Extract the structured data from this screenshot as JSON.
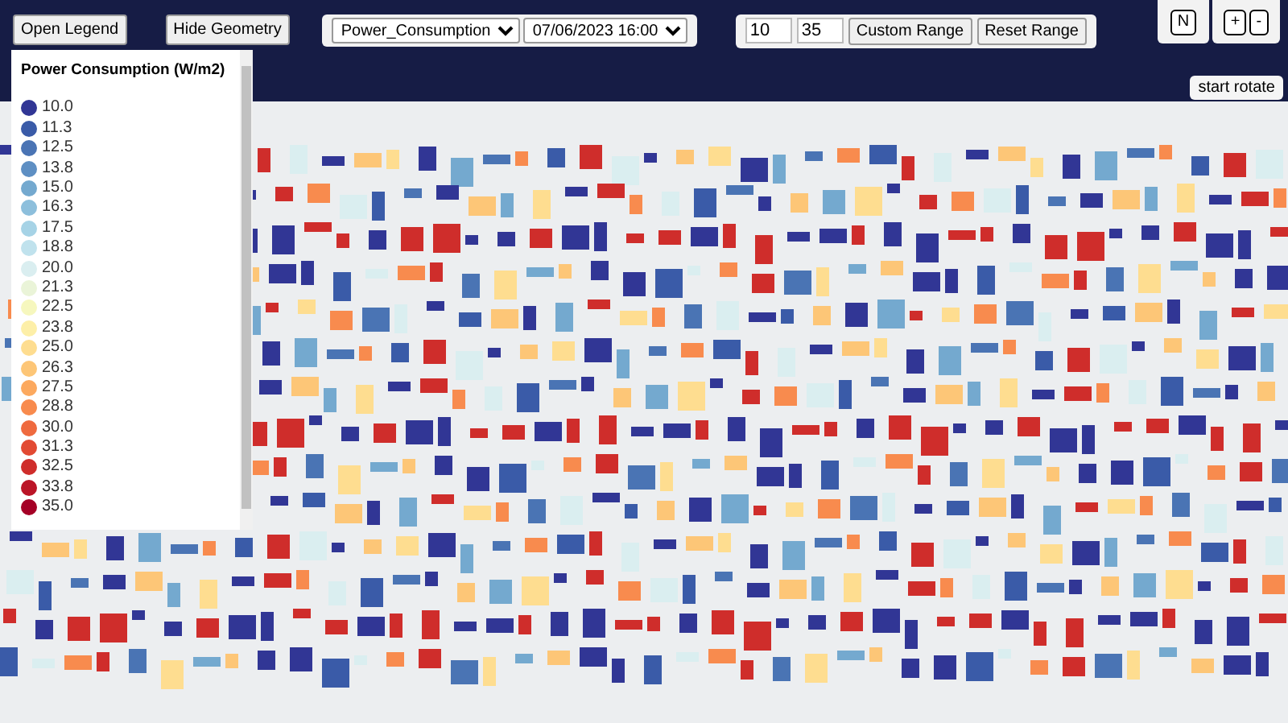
{
  "toolbar": {
    "open_legend": "Open Legend",
    "hide_geometry": "Hide Geometry",
    "metric_select": "Power_Consumption",
    "time_select": "07/06/2023 16:00",
    "range_min": "10",
    "range_max": "35",
    "custom_range": "Custom Range",
    "reset_range": "Reset Range"
  },
  "map_controls": {
    "compass": "N",
    "zoom_in": "+",
    "zoom_out": "-",
    "rotate": "start rotate"
  },
  "legend": {
    "title": "Power Consumption (W/m2)",
    "items": [
      {
        "label": "10.0",
        "color": "#313695"
      },
      {
        "label": "11.3",
        "color": "#3a5ba8"
      },
      {
        "label": "12.5",
        "color": "#4a74b4"
      },
      {
        "label": "13.8",
        "color": "#5e8fc3"
      },
      {
        "label": "15.0",
        "color": "#74a9cf"
      },
      {
        "label": "16.3",
        "color": "#8dbfdc"
      },
      {
        "label": "17.5",
        "color": "#a6d3e6"
      },
      {
        "label": "18.8",
        "color": "#c0e2ed"
      },
      {
        "label": "20.0",
        "color": "#daeef0"
      },
      {
        "label": "21.3",
        "color": "#eaf4d8"
      },
      {
        "label": "22.5",
        "color": "#f6f7be"
      },
      {
        "label": "23.8",
        "color": "#fdefa8"
      },
      {
        "label": "25.0",
        "color": "#fedd90"
      },
      {
        "label": "26.3",
        "color": "#fdc677"
      },
      {
        "label": "27.5",
        "color": "#fca95f"
      },
      {
        "label": "28.8",
        "color": "#f88b4e"
      },
      {
        "label": "30.0",
        "color": "#ef6a3f"
      },
      {
        "label": "31.3",
        "color": "#e24a33"
      },
      {
        "label": "32.5",
        "color": "#cf2d2b"
      },
      {
        "label": "33.8",
        "color": "#bb1527"
      },
      {
        "label": "35.0",
        "color": "#a50026"
      }
    ]
  }
}
